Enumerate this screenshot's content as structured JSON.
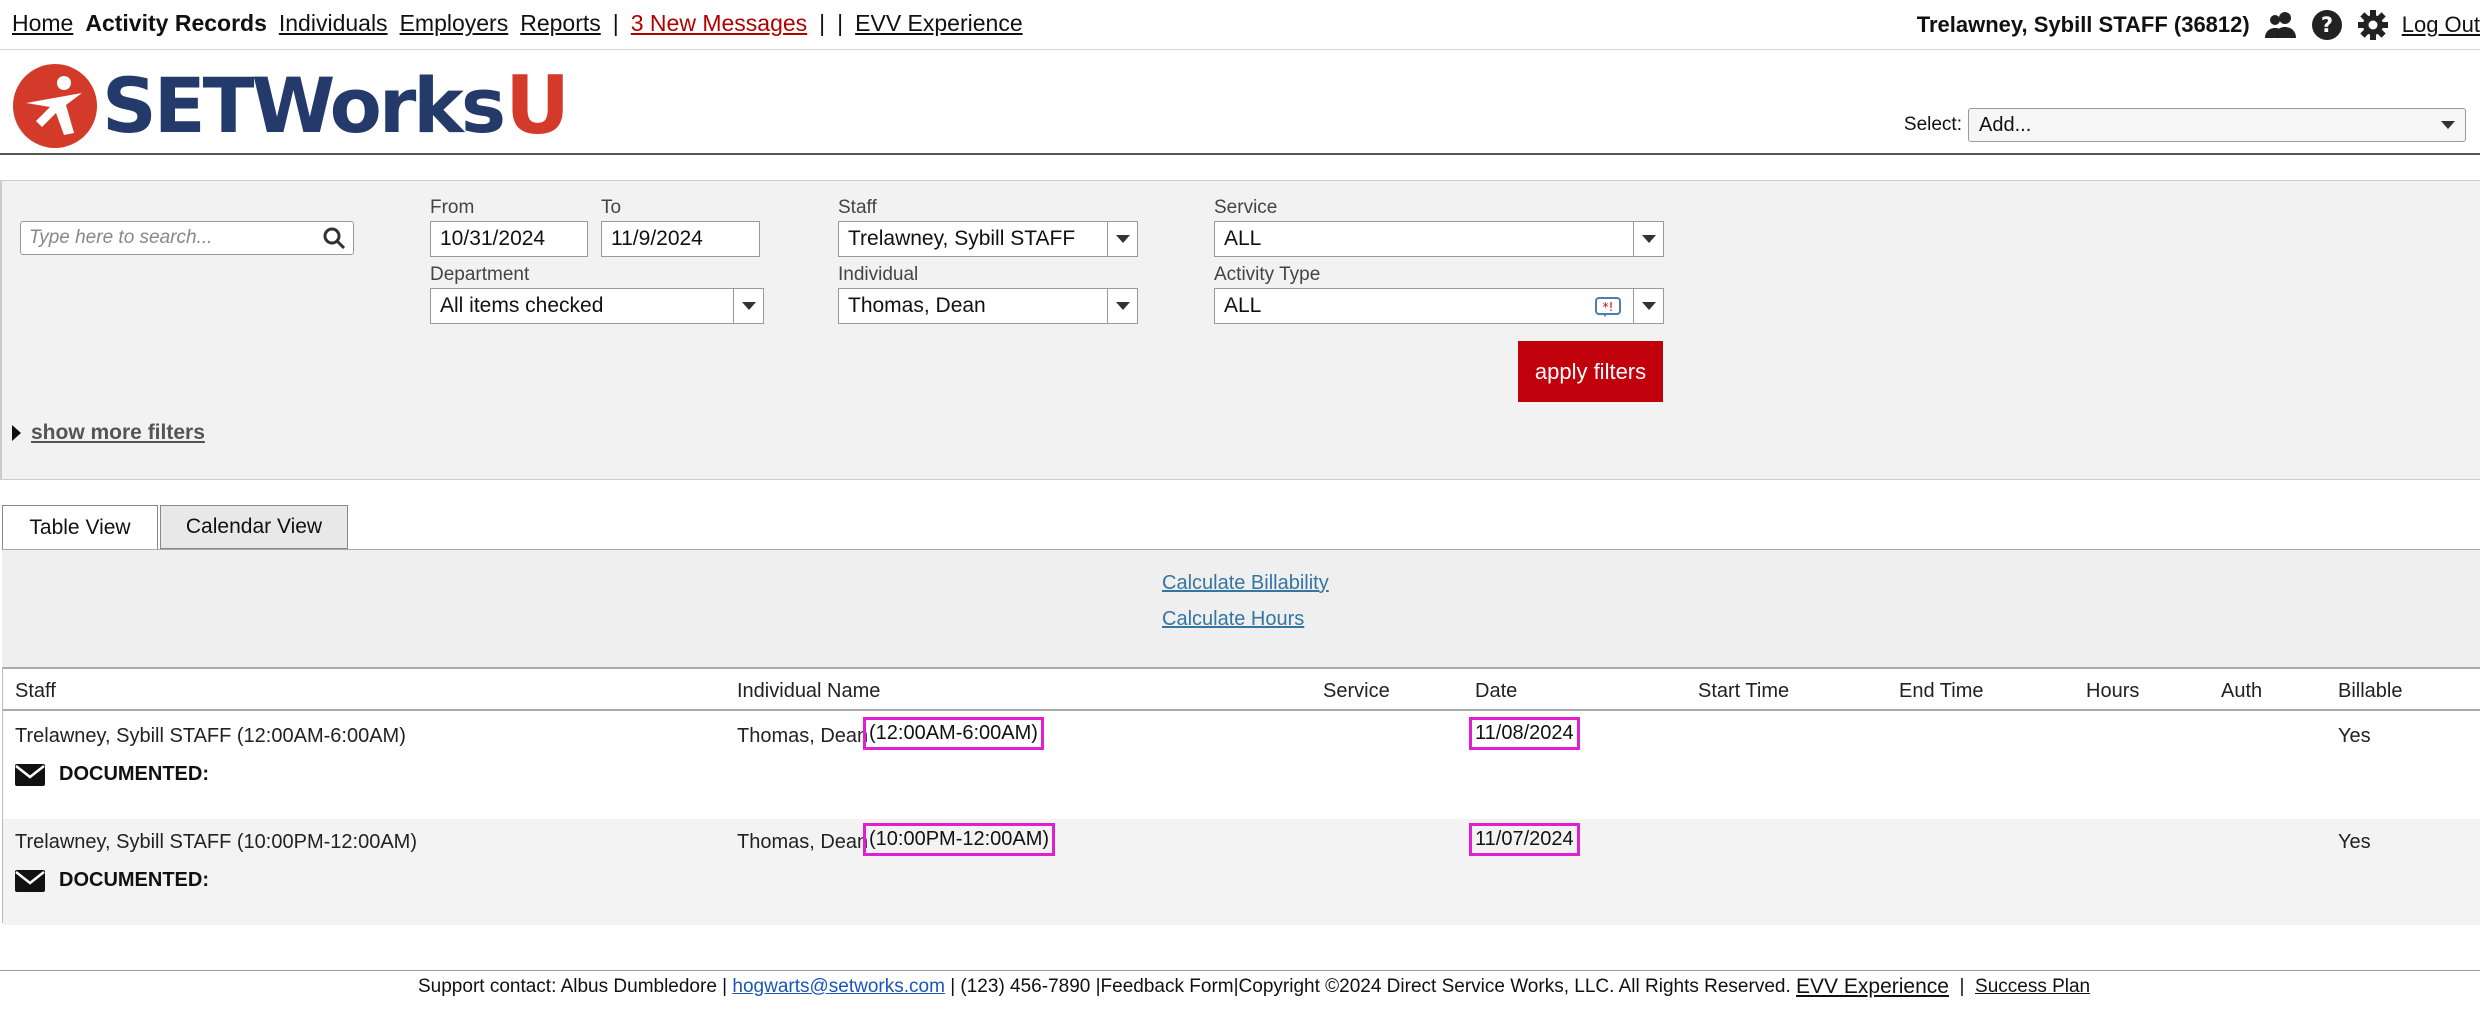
{
  "nav": {
    "home": "Home",
    "activity_records": "Activity Records",
    "individuals": "Individuals",
    "employers": "Employers",
    "reports": "Reports",
    "sep1": "|",
    "messages": "3 New Messages",
    "sep2": "|",
    "sep3": "|",
    "evv": "EVV Experience",
    "user": "Trelawney, Sybill STAFF  (36812)",
    "logout": "Log Out",
    "icons": [
      "people-icon",
      "help-icon",
      "gear-icon"
    ]
  },
  "header": {
    "logo_text": "SETWorks",
    "logo_u": "U",
    "select_label": "Select:",
    "select_value": "Add..."
  },
  "filters": {
    "search_placeholder": "Type here to search...",
    "from_label": "From",
    "from_value": "10/31/2024",
    "to_label": "To",
    "to_value": "11/9/2024",
    "staff_label": "Staff",
    "staff_value": "Trelawney, Sybill STAFF",
    "service_label": "Service",
    "service_value": "ALL",
    "department_label": "Department",
    "department_value": "All items checked",
    "individual_label": "Individual",
    "individual_value": "Thomas, Dean",
    "activity_type_label": "Activity Type",
    "activity_type_value": "ALL",
    "apply_label": "apply filters",
    "more_filters_label": "show more filters"
  },
  "tabs": {
    "table_view": "Table View",
    "calendar_view": "Calendar View"
  },
  "panel": {
    "calc_billability": "Calculate Billability",
    "calc_hours": "Calculate Hours"
  },
  "table": {
    "headers": {
      "staff": "Staff",
      "individual": "Individual Name",
      "service": "Service",
      "date": "Date",
      "start": "Start Time",
      "end": "End Time",
      "hours": "Hours",
      "auth": "Auth",
      "billable": "Billable"
    },
    "rows": [
      {
        "staff": "Trelawney, Sybill STAFF (12:00AM-6:00AM)",
        "individual": "Thomas, Dean",
        "individual_time": "(12:00AM-6:00AM)",
        "date": "11/08/2024",
        "billable": "Yes",
        "documented": "DOCUMENTED:"
      },
      {
        "staff": "Trelawney, Sybill STAFF (10:00PM-12:00AM)",
        "individual": "Thomas, Dean",
        "individual_time": "(10:00PM-12:00AM)",
        "date": "11/07/2024",
        "billable": "Yes",
        "documented": "DOCUMENTED:"
      }
    ]
  },
  "footer": {
    "support": "Support contact: Albus Dumbledore | ",
    "email": "hogwarts@setworks.com",
    "rest": " | (123) 456-7890 |Feedback Form|Copyright ©2024 Direct Service Works, LLC. All Rights Reserved. ",
    "evv": "EVV Experience",
    "sep": "  |  ",
    "plan": "Success Plan"
  },
  "colors": {
    "brand_navy": "#233a6a",
    "brand_red": "#d43a2a",
    "apply_red": "#c0000a",
    "highlight": "#e020d0",
    "link_blue": "#3575a0"
  }
}
